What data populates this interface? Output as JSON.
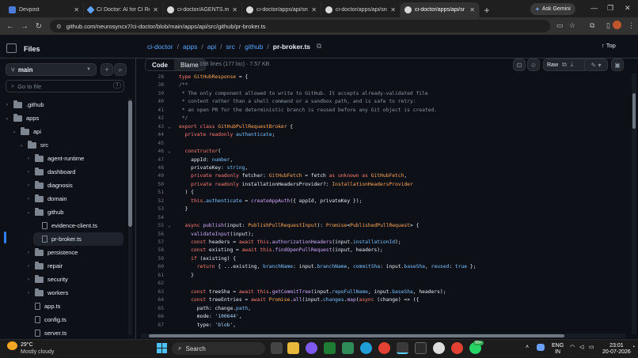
{
  "browser": {
    "tabs": [
      {
        "label": "Devpost",
        "active": false
      },
      {
        "label": "CI Doctor: AI for CI Re",
        "active": false
      },
      {
        "label": "ci-doctor/AGENTS.md",
        "active": false
      },
      {
        "label": "ci-doctor/apps/api/src",
        "active": false
      },
      {
        "label": "ci-doctor/apps/api/src",
        "active": false
      },
      {
        "label": "ci-doctor/apps/api/sr",
        "active": true
      }
    ],
    "new_tab": "+",
    "gemini_label": "Ask Gemini",
    "url": "github.com/neurosyncx7/ci-doctor/blob/main/apps/api/src/github/pr-broker.ts"
  },
  "sidebar": {
    "title": "Files",
    "branch": "main",
    "goto_placeholder": "Go to file",
    "goto_kbd": "t",
    "tree": [
      {
        "label": ".github",
        "type": "folder",
        "depth": 0,
        "expanded": false
      },
      {
        "label": "apps",
        "type": "folder",
        "depth": 0,
        "expanded": true
      },
      {
        "label": "api",
        "type": "folder",
        "depth": 1,
        "expanded": true
      },
      {
        "label": "src",
        "type": "folder",
        "depth": 2,
        "expanded": true
      },
      {
        "label": "agent-runtime",
        "type": "folder",
        "depth": 3,
        "expanded": false
      },
      {
        "label": "dashboard",
        "type": "folder",
        "depth": 3,
        "expanded": false
      },
      {
        "label": "diagnosis",
        "type": "folder",
        "depth": 3,
        "expanded": false
      },
      {
        "label": "domain",
        "type": "folder",
        "depth": 3,
        "expanded": false
      },
      {
        "label": "github",
        "type": "folder",
        "depth": 3,
        "expanded": true
      },
      {
        "label": "evidence-client.ts",
        "type": "file",
        "depth": 4,
        "expanded": false
      },
      {
        "label": "pr-broker.ts",
        "type": "file",
        "depth": 4,
        "expanded": false
      },
      {
        "label": "persistence",
        "type": "folder",
        "depth": 3,
        "expanded": false
      },
      {
        "label": "repair",
        "type": "folder",
        "depth": 3,
        "expanded": false
      },
      {
        "label": "security",
        "type": "folder",
        "depth": 3,
        "expanded": false
      },
      {
        "label": "workers",
        "type": "folder",
        "depth": 3,
        "expanded": false
      },
      {
        "label": "app.ts",
        "type": "file",
        "depth": 3,
        "expanded": false
      },
      {
        "label": "config.ts",
        "type": "file",
        "depth": 3,
        "expanded": false
      },
      {
        "label": "server.ts",
        "type": "file",
        "depth": 3,
        "expanded": false
      }
    ]
  },
  "breadcrumb": {
    "parts": [
      "ci-doctor",
      "apps",
      "api",
      "src",
      "github"
    ],
    "current": "pr-broker.ts",
    "top_label": "Top"
  },
  "file_toolbar": {
    "code_tab": "Code",
    "blame_tab": "Blame",
    "meta": "198 lines (177 loc) · 7.57 KB",
    "raw_label": "Raw"
  },
  "code_lines": [
    {
      "n": "28",
      "fold": "",
      "tokens": [
        [
          "k",
          "type "
        ],
        [
          "o",
          "GitHubResponse"
        ],
        [
          "t",
          " = {"
        ]
      ]
    },
    {
      "n": "38",
      "fold": "",
      "tokens": [
        [
          "c",
          "/**"
        ]
      ]
    },
    {
      "n": "39",
      "fold": "",
      "tokens": [
        [
          "c",
          " * The only component allowed to write to GitHub. It accepts already-validated file"
        ]
      ]
    },
    {
      "n": "40",
      "fold": "",
      "tokens": [
        [
          "c",
          " * content rather than a shell command or a sandbox path, and is safe to retry:"
        ]
      ]
    },
    {
      "n": "41",
      "fold": "",
      "tokens": [
        [
          "c",
          " * an open PR for the deterministic branch is reused before any Git object is created."
        ]
      ]
    },
    {
      "n": "42",
      "fold": "",
      "tokens": [
        [
          "c",
          " */"
        ]
      ]
    },
    {
      "n": "43",
      "fold": "v",
      "tokens": [
        [
          "k",
          "export class "
        ],
        [
          "o",
          "GitHubPullRequestBroker"
        ],
        [
          "t",
          " {"
        ]
      ]
    },
    {
      "n": "44",
      "fold": "",
      "tokens": [
        [
          "k",
          "  private readonly "
        ],
        [
          "p",
          "authenticate"
        ],
        [
          "t",
          ";"
        ]
      ]
    },
    {
      "n": "45",
      "fold": "",
      "tokens": []
    },
    {
      "n": "46",
      "fold": "v",
      "tokens": [
        [
          "k",
          "  constructor"
        ],
        [
          "t",
          "("
        ]
      ]
    },
    {
      "n": "47",
      "fold": "",
      "tokens": [
        [
          "t",
          "    appId: "
        ],
        [
          "p",
          "number"
        ],
        [
          "t",
          ","
        ]
      ]
    },
    {
      "n": "48",
      "fold": "",
      "tokens": [
        [
          "t",
          "    privateKey: "
        ],
        [
          "p",
          "string"
        ],
        [
          "t",
          ","
        ]
      ]
    },
    {
      "n": "49",
      "fold": "",
      "tokens": [
        [
          "k",
          "    private readonly "
        ],
        [
          "t",
          "fetcher: "
        ],
        [
          "o",
          "GitHubFetch"
        ],
        [
          "t",
          " = fetch "
        ],
        [
          "k",
          "as unknown as "
        ],
        [
          "o",
          "GitHubFetch"
        ],
        [
          "t",
          ","
        ]
      ]
    },
    {
      "n": "50",
      "fold": "",
      "tokens": [
        [
          "k",
          "    private readonly "
        ],
        [
          "t",
          "installationHeadersProvider?: "
        ],
        [
          "o",
          "InstallationHeadersProvider"
        ]
      ]
    },
    {
      "n": "51",
      "fold": "",
      "tokens": [
        [
          "t",
          "  ) {"
        ]
      ]
    },
    {
      "n": "52",
      "fold": "",
      "tokens": [
        [
          "k",
          "    this"
        ],
        [
          "t",
          "."
        ],
        [
          "p",
          "authenticate"
        ],
        [
          "t",
          " = "
        ],
        [
          "f",
          "createAppAuth"
        ],
        [
          "t",
          "({ appId, privateKey });"
        ]
      ]
    },
    {
      "n": "53",
      "fold": "",
      "tokens": [
        [
          "t",
          "  }"
        ]
      ]
    },
    {
      "n": "54",
      "fold": "",
      "tokens": []
    },
    {
      "n": "55",
      "fold": "v",
      "tokens": [
        [
          "k",
          "  async "
        ],
        [
          "f",
          "publish"
        ],
        [
          "t",
          "(input: "
        ],
        [
          "o",
          "PublishPullRequestInput"
        ],
        [
          "t",
          "): "
        ],
        [
          "o",
          "Promise"
        ],
        [
          "t",
          "<"
        ],
        [
          "o",
          "PublishedPullRequest"
        ],
        [
          "t",
          "> {"
        ]
      ]
    },
    {
      "n": "56",
      "fold": "",
      "tokens": [
        [
          "f",
          "    validateInput"
        ],
        [
          "t",
          "(input);"
        ]
      ]
    },
    {
      "n": "57",
      "fold": "",
      "tokens": [
        [
          "k",
          "    const "
        ],
        [
          "t",
          "headers = "
        ],
        [
          "k",
          "await this"
        ],
        [
          "t",
          "."
        ],
        [
          "f",
          "authorizationHeaders"
        ],
        [
          "t",
          "(input."
        ],
        [
          "p",
          "installationId"
        ],
        [
          "t",
          ");"
        ]
      ]
    },
    {
      "n": "58",
      "fold": "",
      "tokens": [
        [
          "k",
          "    const "
        ],
        [
          "t",
          "existing = "
        ],
        [
          "k",
          "await this"
        ],
        [
          "t",
          "."
        ],
        [
          "f",
          "findOpenPullRequest"
        ],
        [
          "t",
          "(input, headers);"
        ]
      ]
    },
    {
      "n": "59",
      "fold": "",
      "tokens": [
        [
          "k",
          "    if "
        ],
        [
          "t",
          "(existing) {"
        ]
      ]
    },
    {
      "n": "60",
      "fold": "",
      "tokens": [
        [
          "k",
          "      return "
        ],
        [
          "t",
          "{ ...existing, "
        ],
        [
          "p",
          "branchName"
        ],
        [
          "t",
          ": input."
        ],
        [
          "p",
          "branchName"
        ],
        [
          "t",
          ", "
        ],
        [
          "p",
          "commitSha"
        ],
        [
          "t",
          ": input."
        ],
        [
          "p",
          "baseSha"
        ],
        [
          "t",
          ", "
        ],
        [
          "p",
          "reused"
        ],
        [
          "t",
          ": "
        ],
        [
          "p",
          "true"
        ],
        [
          "t",
          " };"
        ]
      ]
    },
    {
      "n": "61",
      "fold": "",
      "tokens": [
        [
          "t",
          "    }"
        ]
      ]
    },
    {
      "n": "62",
      "fold": "",
      "tokens": []
    },
    {
      "n": "63",
      "fold": "",
      "tokens": [
        [
          "k",
          "    const "
        ],
        [
          "t",
          "treeSha = "
        ],
        [
          "k",
          "await this"
        ],
        [
          "t",
          "."
        ],
        [
          "f",
          "getCommitTree"
        ],
        [
          "t",
          "(input."
        ],
        [
          "p",
          "repoFullName"
        ],
        [
          "t",
          ", input."
        ],
        [
          "p",
          "baseSha"
        ],
        [
          "t",
          ", headers);"
        ]
      ]
    },
    {
      "n": "64",
      "fold": "",
      "tokens": [
        [
          "k",
          "    const "
        ],
        [
          "t",
          "treeEntries = "
        ],
        [
          "k",
          "await "
        ],
        [
          "o",
          "Promise"
        ],
        [
          "t",
          "."
        ],
        [
          "f",
          "all"
        ],
        [
          "t",
          "(input."
        ],
        [
          "p",
          "changes"
        ],
        [
          "t",
          "."
        ],
        [
          "f",
          "map"
        ],
        [
          "t",
          "("
        ],
        [
          "k",
          "async "
        ],
        [
          "t",
          "(change) => ({"
        ]
      ]
    },
    {
      "n": "65",
      "fold": "",
      "tokens": [
        [
          "t",
          "      path: change."
        ],
        [
          "p",
          "path"
        ],
        [
          "t",
          ","
        ]
      ]
    },
    {
      "n": "66",
      "fold": "",
      "tokens": [
        [
          "t",
          "      mode: "
        ],
        [
          "s",
          "'100644'"
        ],
        [
          "t",
          ","
        ]
      ]
    },
    {
      "n": "67",
      "fold": "",
      "tokens": [
        [
          "t",
          "      type: "
        ],
        [
          "s",
          "'blob'"
        ],
        [
          "t",
          ","
        ]
      ]
    }
  ],
  "taskbar": {
    "temp": "29°C",
    "weather": "Mostly cloudy",
    "search": "Search",
    "lang_top": "ENG",
    "lang_bottom": "IN",
    "time": "23:01",
    "date": "20-07-2026",
    "badge": "99+"
  },
  "colors": {
    "accent": "#2f81f7",
    "link": "#58a6ff",
    "keyword": "#ff7b72",
    "function": "#d2a8ff",
    "string": "#a5d6ff",
    "comment": "#8b949e",
    "constant": "#79c0ff",
    "type": "#ffa657"
  }
}
